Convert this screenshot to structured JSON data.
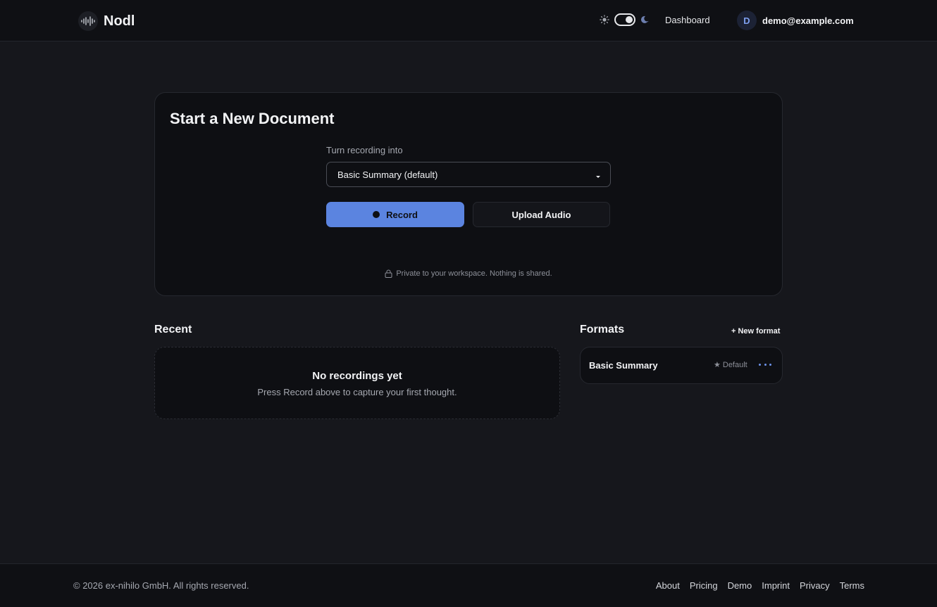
{
  "header": {
    "brand": "Nodl",
    "nav_dashboard": "Dashboard",
    "user_initial": "D",
    "user_email": "demo@example.com",
    "theme_mode": "dark"
  },
  "new_document": {
    "title": "Start a New Document",
    "select_label": "Turn recording into",
    "select_value": "Basic Summary (default)",
    "record_label": "Record",
    "upload_label": "Upload Audio",
    "privacy_note": "Private to your workspace. Nothing is shared."
  },
  "recent": {
    "title": "Recent",
    "empty_title": "No recordings yet",
    "empty_subtitle": "Press Record above to capture your first thought."
  },
  "formats": {
    "title": "Formats",
    "new_format_label": "+ New format",
    "items": [
      {
        "name": "Basic Summary",
        "badge": "Default"
      }
    ]
  },
  "footer": {
    "copyright": "© 2026 ex-nihilo GmbH. All rights reserved.",
    "links": [
      "About",
      "Pricing",
      "Demo",
      "Imprint",
      "Privacy",
      "Terms"
    ]
  },
  "colors": {
    "background": "#16171c",
    "card": "#0e0f13",
    "accent": "#5b84e0"
  }
}
